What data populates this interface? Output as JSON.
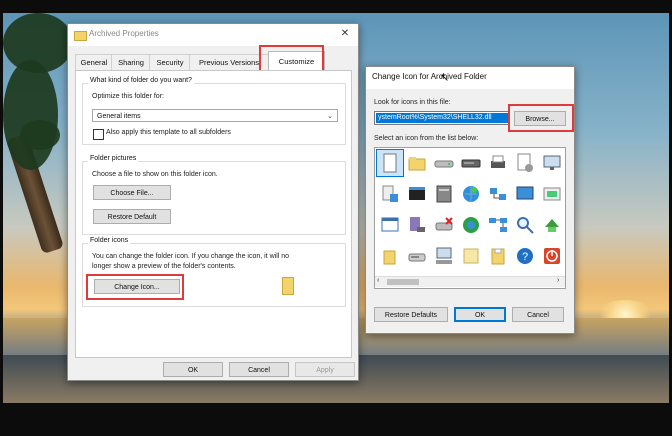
{
  "properties_dialog": {
    "title": "Archived Properties",
    "tabs": [
      {
        "label": "General"
      },
      {
        "label": "Sharing"
      },
      {
        "label": "Security"
      },
      {
        "label": "Previous Versions"
      },
      {
        "label": "Customize"
      }
    ],
    "active_tab": "Customize",
    "optimize_group": {
      "heading": "What kind of folder do you want?",
      "optimize_label": "Optimize this folder for:",
      "selected_option": "General items",
      "checkbox_label": "Also apply this template to all subfolders",
      "checkbox_checked": false
    },
    "pictures_group": {
      "heading": "Folder pictures",
      "description": "Choose a file to show on this folder icon.",
      "choose_file_label": "Choose File...",
      "restore_default_label": "Restore Default"
    },
    "icons_group": {
      "heading": "Folder icons",
      "description_line1": "You can change the folder icon. If you change the icon, it will no",
      "description_line2": "longer show a preview of the folder's contents.",
      "change_icon_label": "Change Icon..."
    },
    "footer": {
      "ok_label": "OK",
      "cancel_label": "Cancel",
      "apply_label": "Apply"
    }
  },
  "change_icon_dialog": {
    "title": "Change Icon for Archived Folder",
    "look_for_label": "Look for icons in this file:",
    "path_value": "ystemRoot%\\System32\\SHELL32.dll",
    "browse_label": "Browse...",
    "select_label": "Select an icon from the list below:",
    "icons": [
      "blank-document-icon",
      "folder-icon",
      "drive-icon",
      "hard-drive-icon",
      "printer-icon",
      "document-gear-icon",
      "monitor-icon",
      "network-computer-icon",
      "console-icon",
      "server-icon",
      "globe-icon",
      "network-share-icon",
      "screen-icon",
      "scanner-icon",
      "window-icon",
      "disk-drive-icon",
      "delete-drive-icon",
      "sync-globe-icon",
      "network-icon",
      "search-icon",
      "recycle-green-icon",
      "folder-small-icon",
      "cd-drive-icon",
      "monitor-keyboard-icon",
      "note-icon",
      "folder-yellow-icon",
      "help-icon",
      "power-icon"
    ],
    "restore_defaults_label": "Restore Defaults",
    "ok_label": "OK",
    "cancel_label": "Cancel"
  },
  "colors": {
    "highlight": "#e03b3b",
    "selection": "#0078d7",
    "folder_yellow": "#f3d36b"
  }
}
